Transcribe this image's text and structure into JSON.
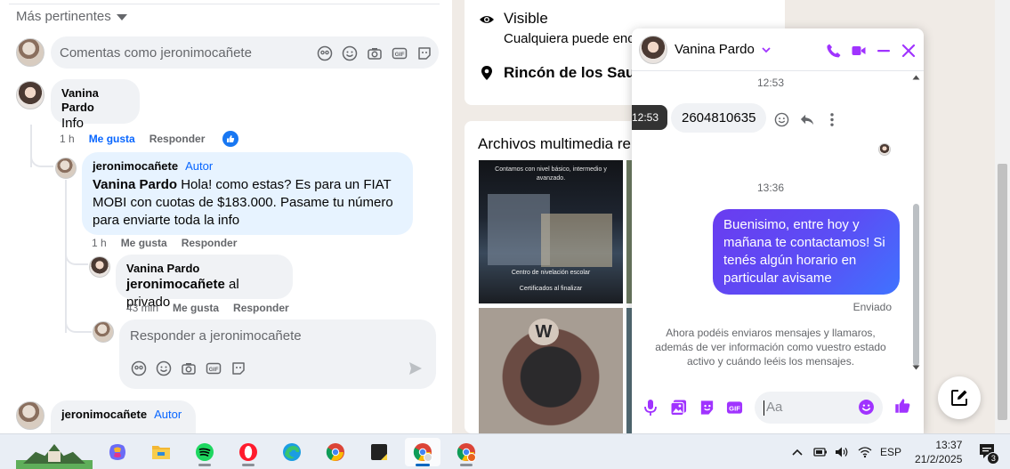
{
  "feed": {
    "sort_label": "Más pertinentes",
    "comment_placeholder": "Comentas como jeronimocañete",
    "reply_placeholder": "Responder a jeronimocañete",
    "comments": [
      {
        "author": "Vanina Pardo",
        "text": "Info",
        "time": "1 h",
        "like": "Me gusta",
        "reply": "Responder"
      },
      {
        "author": "jeronimocañete",
        "badge": "Autor",
        "mention": "Vanina Pardo",
        "text": " Hola! como estas? Es para un FIAT MOBI con cuotas de $183.000. Pasame tu número para enviarte toda la info",
        "time": "1 h",
        "like": "Me gusta",
        "reply": "Responder"
      },
      {
        "author": "Vanina Pardo",
        "mention": "jeronimocañete",
        "text": " al privado",
        "time": "43 min",
        "like": "Me gusta",
        "reply": "Responder"
      },
      {
        "author": "jeronimocañete",
        "badge": "Autor"
      }
    ]
  },
  "post_info": {
    "visibility_title": "Visible",
    "visibility_desc": "Cualquiera puede enc",
    "location": "Rincón de los Sauc",
    "media_title": "Archivos multimedia re",
    "media_1_text_top": "Contamos con nivel básico, intermedio y avanzado.",
    "media_1_text_mid": "Centro de nivelación escolar",
    "media_1_text_bottom": "Certificados al finalizar"
  },
  "chat": {
    "contact_name": "Vanina Pardo",
    "timestamp_1": "12:53",
    "tooltip_time": "12:53",
    "incoming_message": "2604810635",
    "timestamp_2": "13:36",
    "outgoing_message": "Buenisimo, entre hoy y mañana te contactamos! Si tenés algún horario en particular avisame",
    "sent_status": "Enviado",
    "notice": "Ahora podéis enviaros mensajes y llamaros, además de ver información como vuestro estado activo y cuándo leéis los mensajes.",
    "input_placeholder": "Aa",
    "accent_color": "#a033ff"
  },
  "taskbar": {
    "apps": [
      "copilot-icon",
      "file-explorer-icon",
      "spotify-icon",
      "opera-icon",
      "edge-icon",
      "chrome-icon",
      "sticky-notes-icon",
      "chrome-profile-icon",
      "chrome-profile-2-icon"
    ],
    "language": "ESP",
    "time": "13:37",
    "date": "21/2/2025",
    "notification_count": "3"
  }
}
